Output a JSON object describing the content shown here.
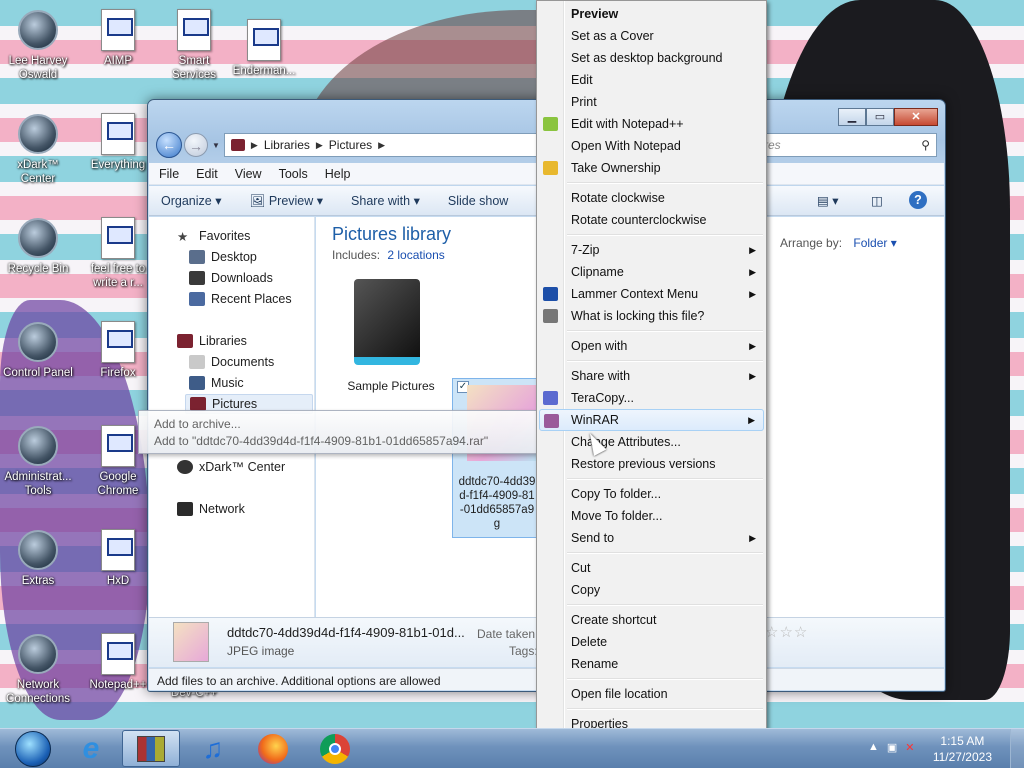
{
  "desktop": {
    "icons": [
      {
        "label": "Lee Harvey Oswald",
        "icon": "person-figure-icon"
      },
      {
        "label": "AIMP",
        "icon": "document-icon"
      },
      {
        "label": "Smart Services",
        "icon": "document-icon"
      },
      {
        "label": "Enderman...",
        "icon": "document-icon"
      },
      {
        "label": "xDark™ Center",
        "icon": "disc-icon"
      },
      {
        "label": "Everything",
        "icon": "document-icon"
      },
      {
        "label": "Recycle Bin",
        "icon": "recycle-bin-icon"
      },
      {
        "label": "feel free to write a r...",
        "icon": "text-file-icon"
      },
      {
        "label": "Control Panel",
        "icon": "control-panel-icon"
      },
      {
        "label": "Firefox",
        "icon": "document-icon"
      },
      {
        "label": "Administrat... Tools",
        "icon": "gears-icon"
      },
      {
        "label": "Google Chrome",
        "icon": "document-icon"
      },
      {
        "label": "Extras",
        "icon": "folder-icon"
      },
      {
        "label": "HxD",
        "icon": "document-icon"
      },
      {
        "label": "Network Connections",
        "icon": "network-icon"
      },
      {
        "label": "Notepad++",
        "icon": "document-icon"
      },
      {
        "label": "Dev-C++",
        "icon": "document-icon"
      }
    ]
  },
  "explorer": {
    "breadcrumb": [
      "Libraries",
      "Pictures"
    ],
    "search_placeholder": "res",
    "menu": [
      "File",
      "Edit",
      "View",
      "Tools",
      "Help"
    ],
    "toolbar": [
      "Organize",
      "Preview",
      "Share with",
      "Slide show"
    ],
    "nav": {
      "favorites_label": "Favorites",
      "favorites": [
        "Desktop",
        "Downloads",
        "Recent Places"
      ],
      "libraries_label": "Libraries",
      "libraries": [
        "Documents",
        "Music",
        "Pictures"
      ],
      "xdark": "xDark™ Center",
      "network": "Network"
    },
    "library_title": "Pictures library",
    "includes_label": "Includes:",
    "includes_link": "2 locations",
    "arrange_label": "Arrange by:",
    "arrange_value": "Folder",
    "items": [
      {
        "name": "Sample Pictures",
        "type": "folder"
      },
      {
        "name": "ddtdc70-4dd39d4d-f1f4-4909-81b1-01dd65857a94.jpg",
        "name_lines": [
          "ddtdc70-4dd39",
          "d-f1f4-4909-81",
          "-01dd65857a9",
          "g"
        ],
        "type": "image",
        "selected": true
      }
    ],
    "details": {
      "filename": "ddtdc70-4dd39d4d-f1f4-4909-81b1-01d...",
      "filetype": "JPEG image",
      "date_label": "Date taken:",
      "tags_label": "Tags:"
    },
    "status": "Add files to an archive. Additional options are allowed"
  },
  "tooltip": {
    "line1": "Add to archive...",
    "line2": "Add to \"ddtdc70-4dd39d4d-f1f4-4909-81b1-01dd65857a94.rar\""
  },
  "context_menu": {
    "items": [
      {
        "label": "Preview",
        "bold": true
      },
      {
        "label": "Set as a Cover"
      },
      {
        "label": "Set as desktop background"
      },
      {
        "label": "Edit"
      },
      {
        "label": "Print"
      },
      {
        "label": "Edit with Notepad++",
        "icon": "notepad-plus-icon"
      },
      {
        "label": "Open With Notepad"
      },
      {
        "label": "Take Ownership",
        "icon": "shield-icon"
      },
      {
        "sep": true
      },
      {
        "label": "Rotate clockwise"
      },
      {
        "label": "Rotate counterclockwise"
      },
      {
        "sep": true
      },
      {
        "label": "7-Zip",
        "submenu": true
      },
      {
        "label": "Clipname",
        "submenu": true
      },
      {
        "label": "Lammer Context Menu",
        "submenu": true,
        "icon": "lammer-icon"
      },
      {
        "label": "What is locking this file?",
        "icon": "magnifier-gear-icon"
      },
      {
        "sep": true
      },
      {
        "label": "Open with",
        "submenu": true
      },
      {
        "sep": true
      },
      {
        "label": "Share with",
        "submenu": true
      },
      {
        "label": "TeraCopy...",
        "icon": "teracopy-icon"
      },
      {
        "label": "WinRAR",
        "submenu": true,
        "icon": "winrar-icon",
        "highlight": true
      },
      {
        "label": "Change Attributes..."
      },
      {
        "label": "Restore previous versions"
      },
      {
        "sep": true
      },
      {
        "label": "Copy To folder..."
      },
      {
        "label": "Move To folder..."
      },
      {
        "label": "Send to",
        "submenu": true
      },
      {
        "sep": true
      },
      {
        "label": "Cut"
      },
      {
        "label": "Copy"
      },
      {
        "sep": true
      },
      {
        "label": "Create shortcut"
      },
      {
        "label": "Delete"
      },
      {
        "label": "Rename"
      },
      {
        "sep": true
      },
      {
        "label": "Open file location"
      },
      {
        "sep": true
      },
      {
        "label": "Properties"
      }
    ]
  },
  "taskbar": {
    "apps": [
      "start-orb-icon",
      "internet-explorer-icon",
      "winrar-icon",
      "music-note-icon",
      "firefox-icon",
      "chrome-icon"
    ],
    "time": "1:15 AM",
    "date": "11/27/2023"
  },
  "colors": {
    "title_blue": "#1e5fa8",
    "link_blue": "#1a4fb0",
    "menu_highlight": "#dcebfc"
  }
}
